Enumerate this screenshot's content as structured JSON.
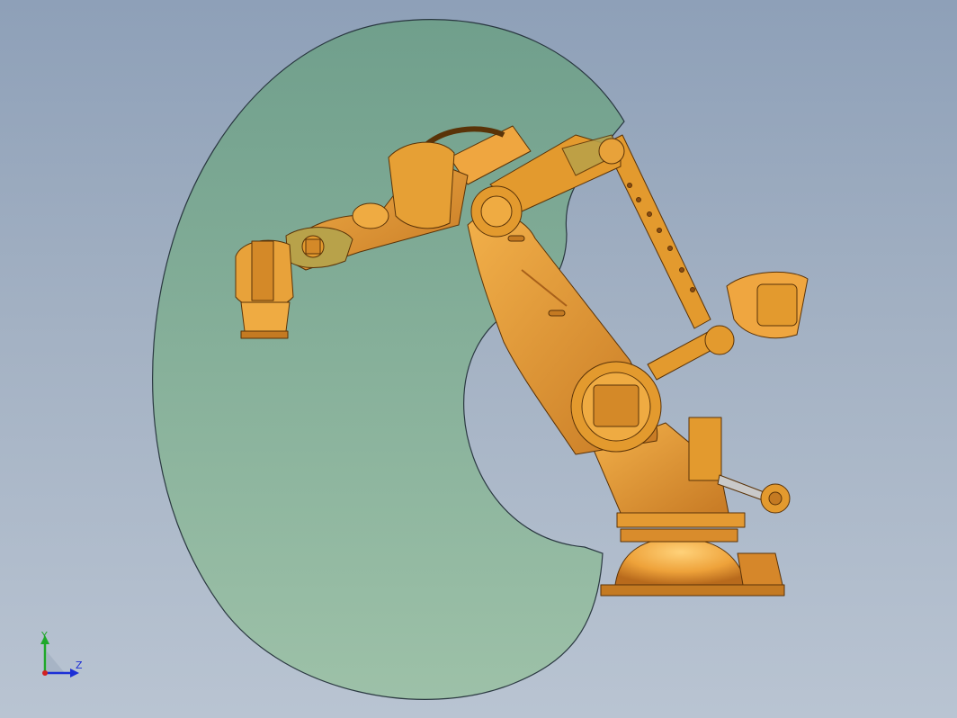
{
  "viewport": {
    "background_top": "#8ea0b8",
    "background_bottom": "#b9c4d2"
  },
  "workspace_envelope": {
    "fill": "#7fb394",
    "stroke": "#24323a"
  },
  "robot": {
    "body_color": "#e39a2e",
    "shadow_color": "#a8601a",
    "highlight_color": "#f6c46a"
  },
  "triad": {
    "y_label": "Y",
    "z_label": "Z",
    "y_color": "#1fa82a",
    "z_color": "#1c2fd6",
    "x_color": "#d22020"
  }
}
